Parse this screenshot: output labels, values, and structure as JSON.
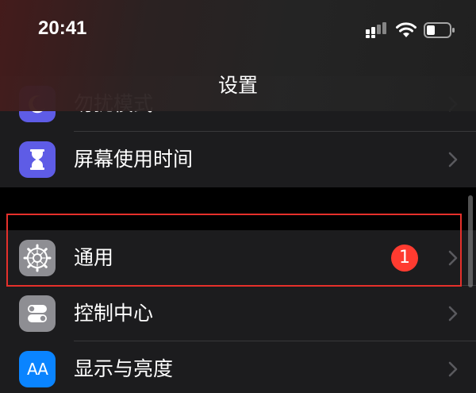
{
  "status_bar": {
    "time": "20:41",
    "icons": [
      "cellular-signal-icon",
      "wifi-icon",
      "battery-icon"
    ]
  },
  "nav": {
    "title": "设置"
  },
  "groups": [
    {
      "rows": [
        {
          "label": "勿扰模式",
          "icon": "moon-icon",
          "partially_hidden": true
        },
        {
          "label": "屏幕使用时间",
          "icon": "hourglass-icon"
        }
      ]
    },
    {
      "rows": [
        {
          "label": "通用",
          "icon": "gear-icon",
          "badge": "1",
          "highlighted": true
        },
        {
          "label": "控制中心",
          "icon": "toggle-switches-icon"
        },
        {
          "label": "显示与亮度",
          "icon": "aa-text-icon",
          "icon_text": "AA"
        }
      ]
    }
  ],
  "colors": {
    "background": "#000000",
    "cell": "#1c1c1e",
    "separator": "#38383a",
    "badge": "#ff3b30",
    "highlight": "#e5302b",
    "screen_time_icon": "#5e5ce6",
    "general_icon": "#8e8e93",
    "display_icon": "#0a84ff"
  }
}
